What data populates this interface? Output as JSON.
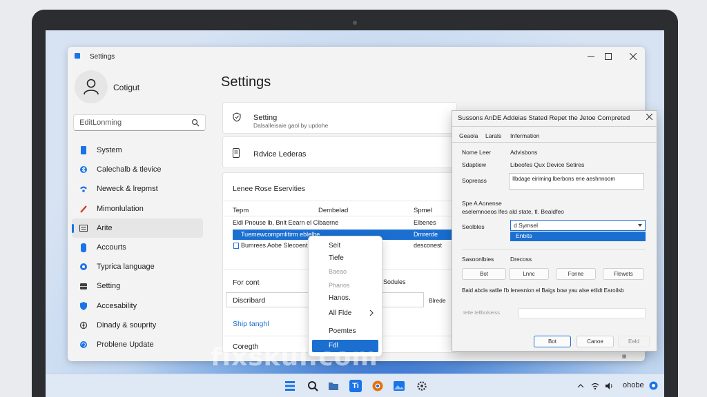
{
  "window": {
    "title": "Settings"
  },
  "user": {
    "name": "Cotigut"
  },
  "search": {
    "value": "EditLonming"
  },
  "sidebar": {
    "items": [
      {
        "label": "System",
        "icon": "system-icon",
        "color": "#1a73e8"
      },
      {
        "label": "Calechalb & tlevice",
        "icon": "bluetooth-icon",
        "color": "#1a73e8"
      },
      {
        "label": "Neweck & lrepmst",
        "icon": "network-icon",
        "color": "#1a73e8"
      },
      {
        "label": "Mimonlulation",
        "icon": "pen-icon",
        "color": "#d93025"
      },
      {
        "label": "Arite",
        "icon": "apps-icon",
        "color": "#3c4043"
      },
      {
        "label": "Accourts",
        "icon": "accounts-icon",
        "color": "#1a73e8"
      },
      {
        "label": "Typrica language",
        "icon": "language-icon",
        "color": "#1a73e8"
      },
      {
        "label": "Setting",
        "icon": "gaming-icon",
        "color": "#3c4043"
      },
      {
        "label": "Accesability",
        "icon": "accessibility-icon",
        "color": "#1a73e8"
      },
      {
        "label": "Dinady & souprity",
        "icon": "privacy-icon",
        "color": "#3c4043"
      },
      {
        "label": "Problene Update",
        "icon": "update-icon",
        "color": "#1a73e8"
      }
    ]
  },
  "main": {
    "title": "Settings",
    "card1": {
      "title": "Setting",
      "subtitle": "Dalsalleisaie gaol by updohe"
    },
    "card2": {
      "title": "Rdvice Lederas"
    },
    "section": {
      "title": "Lenee Rose Eservities",
      "headers": [
        "Tepm",
        "Dembelad",
        "Spmel"
      ],
      "rows": [
        [
          "Eldl Pnouse lb, Bnlt Eearn el Clbaerne",
          "",
          "Elbenes"
        ],
        [
          "Tuemewcompmlitirm eblelbe",
          "",
          "Dmrerde"
        ],
        [
          "Bumrees Aobe Slecoent",
          "",
          "desconest"
        ]
      ]
    },
    "for_cont": "For cont",
    "discribard": "Discribard",
    "ship": "Ship tanghl",
    "coregth": "Coregth",
    "sodules": "Sodules",
    "blrede": "Blrede"
  },
  "context_menu": {
    "items": [
      {
        "label": "Seit",
        "disabled": false
      },
      {
        "label": "Tiefe",
        "disabled": false
      },
      {
        "label": "Baeao",
        "disabled": true
      },
      {
        "label": "Phanos",
        "disabled": true
      },
      {
        "label": "Hanos.",
        "disabled": false
      },
      {
        "label": "All Flde",
        "disabled": false
      },
      {
        "label": "Poemtes",
        "disabled": false
      },
      {
        "label": "Fdl",
        "disabled": false
      }
    ]
  },
  "dialog": {
    "title": "Sussons AnDE Addeias Stated Repet the Jetoe Compreted",
    "tabs": [
      "Geaola",
      "Larals",
      "Infermation"
    ],
    "name_label": "Nome Leer",
    "name_value": "Advisbons",
    "type_label": "Sdaptiew",
    "type_value": "Libeofes Qux Device Setires",
    "desc_label": "Sopreass",
    "desc_value": "Ilbdage eiriming lberbons ene aeshnnoom",
    "section_label": "Spe A Aonense",
    "section_text": "eselemnoeos lfes ald state, tl. Bealdfeo",
    "select_label": "Seolbles",
    "select_value": "d Symsel",
    "option_selected": "Enbits",
    "opt_label": "Sasoonlbies",
    "opt_value": "Drecoss",
    "buttons_row": [
      "Bot",
      "Lnnc",
      "Fonne",
      "Flewets"
    ],
    "note_text": "Baid abcla satlie l'b lenesnion el Baigs bow yau alse etlidt Earoilsb",
    "extra_label": "Ietle tellbnlseiss",
    "ok": "Bot",
    "cancel": "Canoe",
    "apply": "Eeld"
  },
  "taskbar": {
    "tray_text": "ohobe"
  }
}
